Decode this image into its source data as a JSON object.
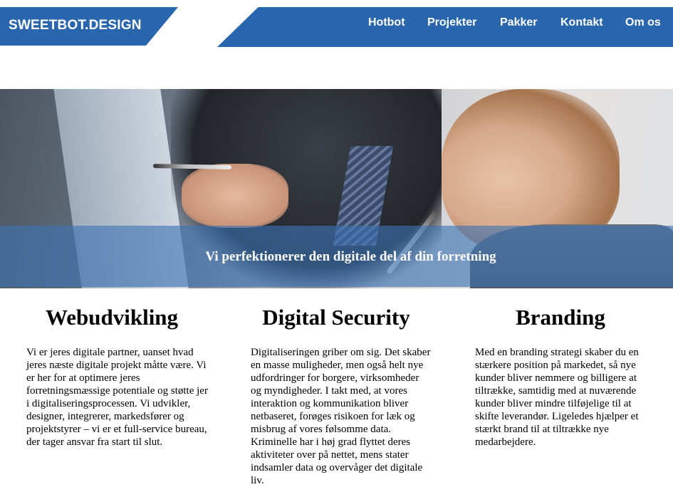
{
  "header": {
    "logo": "SWEETBOT.DESIGN",
    "brand_color": "#2a66ad",
    "nav": [
      {
        "label": "Hotbot"
      },
      {
        "label": "Projekter"
      },
      {
        "label": "Pakker"
      },
      {
        "label": "Kontakt"
      },
      {
        "label": "Om os"
      }
    ]
  },
  "hero": {
    "caption": "Vi perfektionerer den digitale del af din forretning"
  },
  "columns": [
    {
      "title": "Webudvikling",
      "text": "Vi er jeres digitale partner, uanset hvad jeres næste digitale projekt måtte være. Vi er her for at optimere jeres forretningsmæssige potentiale og støtte jer i digitaliseringsprocessen. Vi udvikler, designer, integrerer, markedsfører og projektstyrer – vi er et full-service bureau, der tager ansvar fra start til slut."
    },
    {
      "title": "Digital Security",
      "text": "Digitaliseringen griber om sig. Det skaber en masse muligheder, men også helt nye udfordringer for borgere, virksomheder og myndigheder. I takt med, at vores interaktion og kommunikation bliver netbaseret, forøges risikoen for læk og misbrug af vores følsomme data. Kriminelle har i høj grad flyttet deres aktiviteter over på nettet, mens stater indsamler data og overvåger det digitale liv."
    },
    {
      "title": "Branding",
      "text": "Med en branding strategi skaber du en stærkere position på markedet, så nye kunder bliver nemmere og billigere at tiltrække, samtidig med at nuværende kunder bliver mindre tilføjelige til at skifte leverandør. Ligeledes hjælper et stærkt brand til at tiltrække nye medarbejdere."
    }
  ]
}
